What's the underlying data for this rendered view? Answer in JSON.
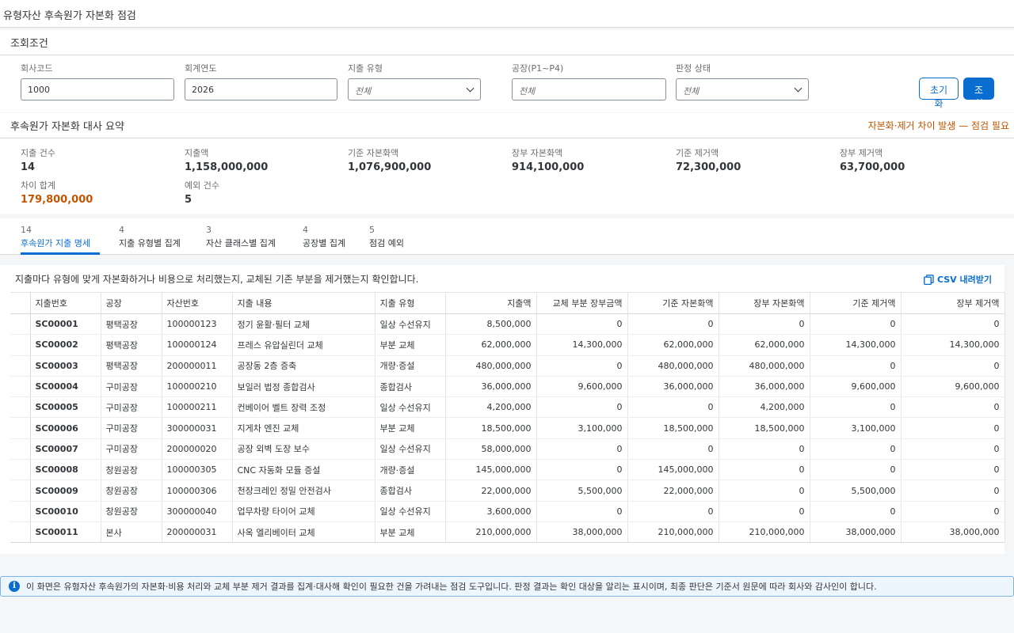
{
  "app": {
    "title": "유형자산 후속원가 자본화 점검"
  },
  "filters": {
    "title": "조회조건",
    "company_code": {
      "label": "회사코드",
      "value": "1000"
    },
    "fiscal_year": {
      "label": "회계연도",
      "value": "2026"
    },
    "expense_type": {
      "label": "지출 유형",
      "value": "전체"
    },
    "plant": {
      "label": "공장(P1~P4)",
      "placeholder": "전체"
    },
    "judgement": {
      "label": "판정 상태",
      "value": "전체"
    },
    "reset_label": "초기화",
    "search_label": "조회"
  },
  "summary": {
    "title": "후속원가 자본화 대사 요약",
    "warning": "자본화·제거 차이 발생 — 점검 필요",
    "kpis": [
      {
        "label": "지출 건수",
        "value": "14"
      },
      {
        "label": "지출액",
        "value": "1,158,000,000"
      },
      {
        "label": "기준 자본화액",
        "value": "1,076,900,000"
      },
      {
        "label": "장부 자본화액",
        "value": "914,100,000"
      },
      {
        "label": "기준 제거액",
        "value": "72,300,000"
      },
      {
        "label": "장부 제거액",
        "value": "63,700,000"
      },
      {
        "label": "차이 합계",
        "value": "179,800,000"
      },
      {
        "label": "예외 건수",
        "value": "5"
      }
    ]
  },
  "tabs": [
    {
      "count": "14",
      "label": "후속원가 지출 명세"
    },
    {
      "count": "4",
      "label": "지출 유형별 집계"
    },
    {
      "count": "3",
      "label": "자산 클래스별 집계"
    },
    {
      "count": "4",
      "label": "공장별 집계"
    },
    {
      "count": "5",
      "label": "점검 예외"
    }
  ],
  "table": {
    "description": "지출마다 유형에 맞게 자본화하거나 비용으로 처리했는지, 교체된 기존 부분을 제거했는지 확인합니다.",
    "csv_label": "CSV 내려받기",
    "columns": [
      "지출번호",
      "공장",
      "자산번호",
      "지출 내용",
      "지출 유형",
      "지출액",
      "교체 부분 장부금액",
      "기준 자본화액",
      "장부 자본화액",
      "기준 제거액",
      "장부 제거액"
    ],
    "rows": [
      [
        "SC00001",
        "평택공장",
        "100000123",
        "정기 윤활·필터 교체",
        "일상 수선유지",
        "8,500,000",
        "0",
        "0",
        "0",
        "0",
        "0"
      ],
      [
        "SC00002",
        "평택공장",
        "100000124",
        "프레스 유압실린더 교체",
        "부분 교체",
        "62,000,000",
        "14,300,000",
        "62,000,000",
        "62,000,000",
        "14,300,000",
        "14,300,000"
      ],
      [
        "SC00003",
        "평택공장",
        "200000011",
        "공장동 2층 증축",
        "개량·증설",
        "480,000,000",
        "0",
        "480,000,000",
        "480,000,000",
        "0",
        "0"
      ],
      [
        "SC00004",
        "구미공장",
        "100000210",
        "보일러 법정 종합검사",
        "종합검사",
        "36,000,000",
        "9,600,000",
        "36,000,000",
        "36,000,000",
        "9,600,000",
        "9,600,000"
      ],
      [
        "SC00005",
        "구미공장",
        "100000211",
        "컨베이어 벨트 장력 조정",
        "일상 수선유지",
        "4,200,000",
        "0",
        "0",
        "4,200,000",
        "0",
        "0"
      ],
      [
        "SC00006",
        "구미공장",
        "300000031",
        "지게차 엔진 교체",
        "부분 교체",
        "18,500,000",
        "3,100,000",
        "18,500,000",
        "18,500,000",
        "3,100,000",
        "0"
      ],
      [
        "SC00007",
        "구미공장",
        "200000020",
        "공장 외벽 도장 보수",
        "일상 수선유지",
        "58,000,000",
        "0",
        "0",
        "0",
        "0",
        "0"
      ],
      [
        "SC00008",
        "창원공장",
        "100000305",
        "CNC 자동화 모듈 증설",
        "개량·증설",
        "145,000,000",
        "0",
        "145,000,000",
        "0",
        "0",
        "0"
      ],
      [
        "SC00009",
        "창원공장",
        "100000306",
        "천장크레인 정밀 안전검사",
        "종합검사",
        "22,000,000",
        "5,500,000",
        "22,000,000",
        "0",
        "5,500,000",
        "0"
      ],
      [
        "SC00010",
        "창원공장",
        "300000040",
        "업무차량 타이어 교체",
        "일상 수선유지",
        "3,600,000",
        "0",
        "0",
        "0",
        "0",
        "0"
      ],
      [
        "SC00011",
        "본사",
        "200000031",
        "사옥 엘리베이터 교체",
        "부분 교체",
        "210,000,000",
        "38,000,000",
        "210,000,000",
        "210,000,000",
        "38,000,000",
        "38,000,000"
      ]
    ]
  },
  "info": {
    "text": "이 화면은 유형자산 후속원가의 자본화·비용 처리와 교체 부분 제거 결과를 집계·대사해 확인이 필요한 건을 가려내는 점검 도구입니다. 판정 결과는 확인 대상을 알리는 표시이며, 최종 판단은 기준서 원문에 따라 회사와 감사인이 합니다."
  },
  "colors": {
    "accent": "#0a6ed1",
    "warning": "#c35500"
  }
}
